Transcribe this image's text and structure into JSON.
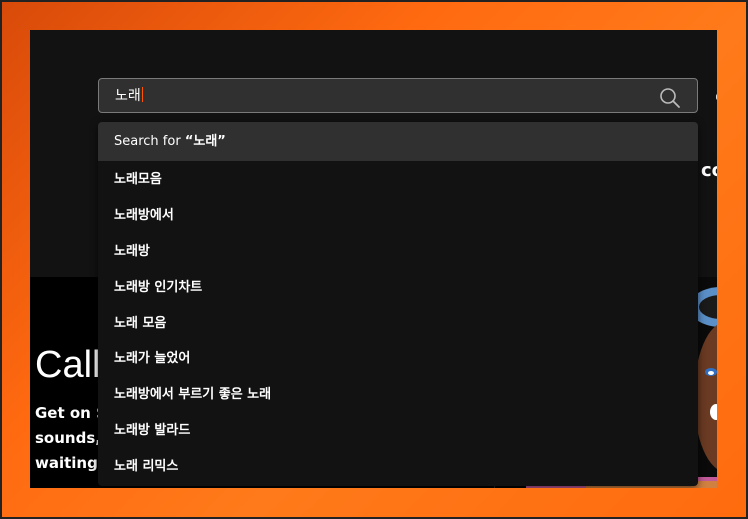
{
  "search": {
    "value": "노래"
  },
  "dropdown": {
    "search_for_prefix": "Search for ",
    "search_for_query": "“노래”",
    "suggestions": [
      "노래모음",
      "노래방에서",
      "노래방",
      "노래방 인기차트",
      "노래 모음",
      "노래가 늘었어",
      "노래방에서 부르기 좋은 노래",
      "노래방 발라드",
      "노래 리믹스"
    ]
  },
  "background": {
    "right_partial": "co",
    "hero_title": "Call",
    "hero_lines": [
      "Get on S",
      "sounds,",
      "waiting"
    ]
  },
  "colors": {
    "accent": "#ff5500",
    "app_bg": "#121212",
    "dropdown_highlight": "#303030",
    "desktop_orange": "#ff6a10"
  }
}
